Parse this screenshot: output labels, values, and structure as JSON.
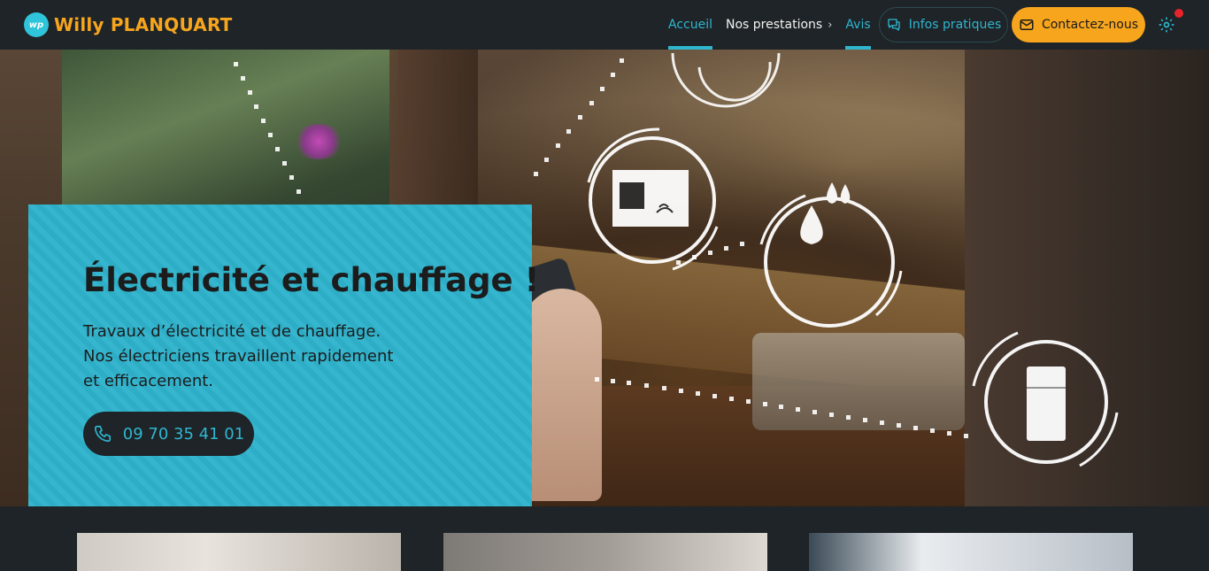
{
  "brand": {
    "badge": "wp",
    "name": "Willy PLANQUART"
  },
  "nav": {
    "items": [
      {
        "label": "Accueil",
        "active": true
      },
      {
        "label": "Nos prestations",
        "has_submenu": true
      },
      {
        "label": "Avis",
        "active_underline": true
      }
    ],
    "infos_label": "Infos pratiques",
    "contact_label": "Contactez-nous"
  },
  "hero": {
    "title_bold": "Électricité",
    "title_rest": " et chauffage !",
    "lines": [
      "Travaux d’électricité et de chauffage.",
      "Nos électriciens travaillent rapidement",
      "et efficacement."
    ],
    "phone": "09 70 35 41 01"
  },
  "colors": {
    "accent": "#2fb6cf",
    "orange": "#f7a51d",
    "dark": "#1e2428",
    "notification": "#e8242b"
  },
  "icons": [
    "phone-icon",
    "chat-icon",
    "mail-icon",
    "gear-icon",
    "chevron-right-icon"
  ]
}
